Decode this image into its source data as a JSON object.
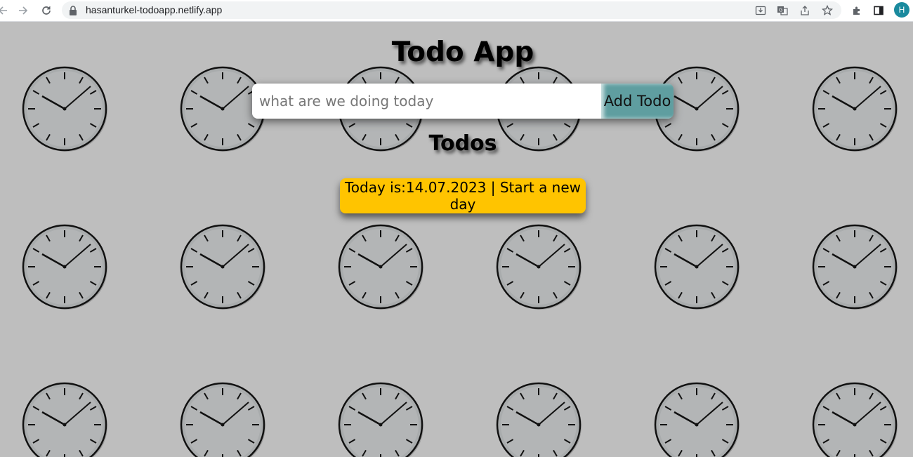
{
  "browser": {
    "url": "hasanturkel-todoapp.netlify.app",
    "avatar_initial": "H",
    "icons": [
      "back-icon",
      "forward-icon",
      "reload-icon",
      "lock-icon",
      "install-icon",
      "translate-icon",
      "share-icon",
      "bookmark-star-icon",
      "extensions-icon",
      "side-panel-icon"
    ]
  },
  "app": {
    "title": "Todo App",
    "input_placeholder": "what are we doing today",
    "input_value": "",
    "add_button_label": "Add Todo",
    "todos_heading": "Todos",
    "date_card_text": "Today is:14.07.2023 | Start a new day"
  },
  "colors": {
    "background": "#bebebe",
    "add_button": "#5f9ea0",
    "date_card": "#ffc400",
    "avatar": "#1a8a9e"
  },
  "background_pattern": "clock-icon"
}
